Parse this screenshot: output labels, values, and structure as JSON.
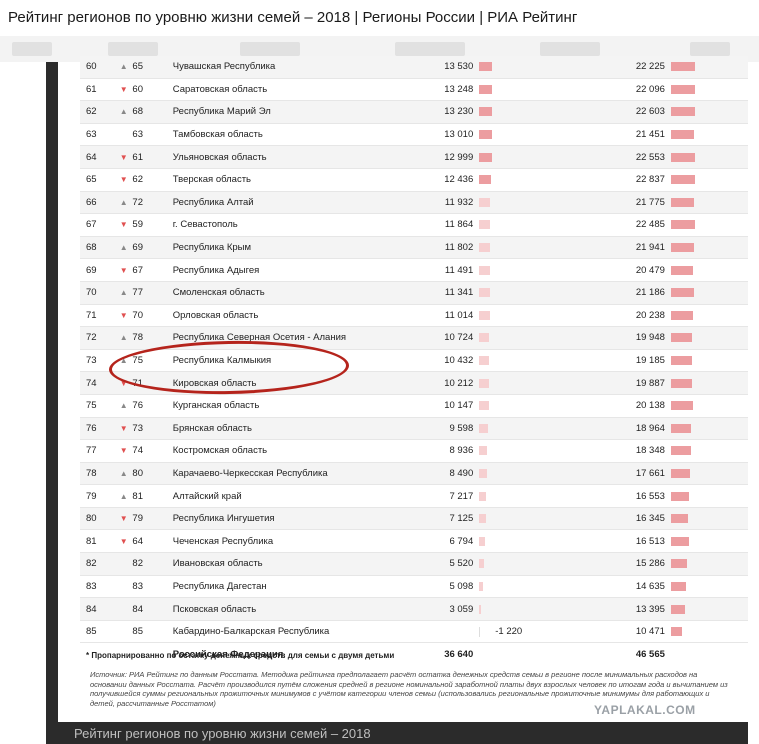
{
  "window": {
    "title": "Рейтинг регионов по уровню жизни семей – 2018 | Регионы России | РИА Рейтинг"
  },
  "rows": [
    {
      "pos": "60",
      "arrow": "▲",
      "dir": "up",
      "prev": "65",
      "region": "Чувашская Республика",
      "v1": "13 530",
      "b1": 13,
      "v2": "22 225",
      "b2": 24
    },
    {
      "pos": "61",
      "arrow": "▼",
      "dir": "down",
      "prev": "60",
      "region": "Саратовская область",
      "v1": "13 248",
      "b1": 13,
      "v2": "22 096",
      "b2": 24
    },
    {
      "pos": "62",
      "arrow": "▲",
      "dir": "up",
      "prev": "68",
      "region": "Республика Марий Эл",
      "v1": "13 230",
      "b1": 13,
      "v2": "22 603",
      "b2": 24
    },
    {
      "pos": "63",
      "arrow": "",
      "dir": "",
      "prev": "63",
      "region": "Тамбовская область",
      "v1": "13 010",
      "b1": 13,
      "v2": "21 451",
      "b2": 23
    },
    {
      "pos": "64",
      "arrow": "▼",
      "dir": "down",
      "prev": "61",
      "region": "Ульяновская область",
      "v1": "12 999",
      "b1": 13,
      "v2": "22 553",
      "b2": 24
    },
    {
      "pos": "65",
      "arrow": "▼",
      "dir": "down",
      "prev": "62",
      "region": "Тверская область",
      "v1": "12 436",
      "b1": 12,
      "v2": "22 837",
      "b2": 24
    },
    {
      "pos": "66",
      "arrow": "▲",
      "dir": "up",
      "prev": "72",
      "region": "Республика Алтай",
      "v1": "11 932",
      "b1": 11,
      "v2": "21 775",
      "b2": 23
    },
    {
      "pos": "67",
      "arrow": "▼",
      "dir": "down",
      "prev": "59",
      "region": "г. Севастополь",
      "v1": "11 864",
      "b1": 11,
      "v2": "22 485",
      "b2": 24
    },
    {
      "pos": "68",
      "arrow": "▲",
      "dir": "up",
      "prev": "69",
      "region": "Республика Крым",
      "v1": "11 802",
      "b1": 11,
      "v2": "21 941",
      "b2": 23
    },
    {
      "pos": "69",
      "arrow": "▼",
      "dir": "down",
      "prev": "67",
      "region": "Республика Адыгея",
      "v1": "11 491",
      "b1": 11,
      "v2": "20 479",
      "b2": 22
    },
    {
      "pos": "70",
      "arrow": "▲",
      "dir": "up",
      "prev": "77",
      "region": "Смоленская область",
      "v1": "11 341",
      "b1": 11,
      "v2": "21 186",
      "b2": 23
    },
    {
      "pos": "71",
      "arrow": "▼",
      "dir": "down",
      "prev": "70",
      "region": "Орловская область",
      "v1": "11 014",
      "b1": 11,
      "v2": "20 238",
      "b2": 22
    },
    {
      "pos": "72",
      "arrow": "▲",
      "dir": "up",
      "prev": "78",
      "region": "Республика Северная Осетия - Алания",
      "v1": "10 724",
      "b1": 10,
      "v2": "19 948",
      "b2": 21
    },
    {
      "pos": "73",
      "arrow": "▲",
      "dir": "up",
      "prev": "75",
      "region": "Республика Калмыкия",
      "v1": "10 432",
      "b1": 10,
      "v2": "19 185",
      "b2": 21
    },
    {
      "pos": "74",
      "arrow": "▼",
      "dir": "down",
      "prev": "71",
      "region": "Кировская область",
      "v1": "10 212",
      "b1": 10,
      "v2": "19 887",
      "b2": 21
    },
    {
      "pos": "75",
      "arrow": "▲",
      "dir": "up",
      "prev": "76",
      "region": "Курганская область",
      "v1": "10 147",
      "b1": 10,
      "v2": "20 138",
      "b2": 22
    },
    {
      "pos": "76",
      "arrow": "▼",
      "dir": "down",
      "prev": "73",
      "region": "Брянская область",
      "v1": "9 598",
      "b1": 9,
      "v2": "18 964",
      "b2": 20
    },
    {
      "pos": "77",
      "arrow": "▼",
      "dir": "down",
      "prev": "74",
      "region": "Костромская область",
      "v1": "8 936",
      "b1": 8,
      "v2": "18 348",
      "b2": 20
    },
    {
      "pos": "78",
      "arrow": "▲",
      "dir": "up",
      "prev": "80",
      "region": "Карачаево-Черкесская Республика",
      "v1": "8 490",
      "b1": 8,
      "v2": "17 661",
      "b2": 19
    },
    {
      "pos": "79",
      "arrow": "▲",
      "dir": "up",
      "prev": "81",
      "region": "Алтайский край",
      "v1": "7 217",
      "b1": 7,
      "v2": "16 553",
      "b2": 18
    },
    {
      "pos": "80",
      "arrow": "▼",
      "dir": "down",
      "prev": "79",
      "region": "Республика Ингушетия",
      "v1": "7 125",
      "b1": 7,
      "v2": "16 345",
      "b2": 17
    },
    {
      "pos": "81",
      "arrow": "▼",
      "dir": "down",
      "prev": "64",
      "region": "Чеченская Республика",
      "v1": "6 794",
      "b1": 6,
      "v2": "16 513",
      "b2": 18
    },
    {
      "pos": "82",
      "arrow": "",
      "dir": "",
      "prev": "82",
      "region": "Ивановская область",
      "v1": "5 520",
      "b1": 5,
      "v2": "15 286",
      "b2": 16
    },
    {
      "pos": "83",
      "arrow": "",
      "dir": "",
      "prev": "83",
      "region": "Республика Дагестан",
      "v1": "5 098",
      "b1": 4,
      "v2": "14 635",
      "b2": 15
    },
    {
      "pos": "84",
      "arrow": "",
      "dir": "",
      "prev": "84",
      "region": "Псковская область",
      "v1": "3 059",
      "b1": 2,
      "v2": "13 395",
      "b2": 14
    },
    {
      "pos": "85",
      "arrow": "",
      "dir": "",
      "prev": "85",
      "region": "Кабардино-Балкарская Республика",
      "v1": "",
      "b1": 0,
      "neg": "-1 220",
      "v2": "10 471",
      "b2": 11
    }
  ],
  "total": {
    "region": "Российская Федерация",
    "v1": "36 640",
    "v2": "46 565"
  },
  "footnote": "* Пропарнированно по остатку денежных средств для семьи с двумя детьми",
  "source": "Источник: РИА Рейтинг по данным Росстата. Методика рейтинга предполагает расчёт остатка денежных средств семьи в регионе после минимальных расходов на основании данных Росстата. Расчёт производился путём сложения средней в регионе номинальной заработной платы двух взрослых человек по итогам года и вычитанием из получившейся суммы региональных прожиточных минимумов с учётом категории членов семьи (использовались региональные прожиточные минимумы для работающих и детей, рассчитанные Росстатом)",
  "watermark": "YAPLAKAL.COM",
  "footer_title": "Рейтинг регионов по уровню жизни семей – 2018",
  "colors": {
    "bar_light": "#f6cfd0",
    "bar_strong": "#ec9da0",
    "arrow_down": "#e05050",
    "highlight_ellipse": "#b5241c"
  }
}
